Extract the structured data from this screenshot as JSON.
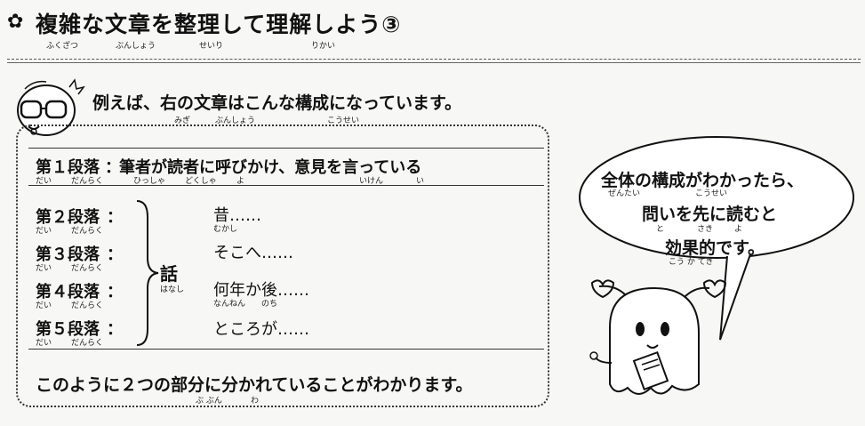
{
  "header": {
    "title": "複雑な文章を整理して理解しよう③",
    "ruby": [
      "ふくざつ",
      "ぶんしょう",
      "せいり",
      "りかい"
    ]
  },
  "intro": {
    "text": "例えば、右の文章はこんな構成になっています。",
    "ruby": [
      "みぎ",
      "ぶんしょう",
      "こうせい"
    ]
  },
  "para1": {
    "label": "第１段落",
    "ruby_label": [
      "だい",
      "だんらく"
    ],
    "text": "筆者が読者に呼びかけ、意見を言っている",
    "ruby_text": [
      "ひっしゃ",
      "どくしゃ",
      "よ",
      "いけん",
      "い"
    ]
  },
  "story_paras": [
    {
      "label": "第２段落",
      "content": "昔……",
      "ruby": "むかし"
    },
    {
      "label": "第３段落",
      "content": "そこへ……",
      "ruby": ""
    },
    {
      "label": "第４段落",
      "content": "何年か後……",
      "ruby": "なんねん　　のち"
    },
    {
      "label": "第５段落",
      "content": "ところが……",
      "ruby": ""
    }
  ],
  "label_ruby": [
    "だい",
    "だんらく"
  ],
  "colon": "：",
  "story": {
    "label": "話",
    "ruby": "はなし"
  },
  "summary": {
    "text": "このように２つの部分に分かれていることがわかります。",
    "ruby": [
      "ぶ ぶん",
      "わ"
    ]
  },
  "speech": {
    "line1": "全体の構成がわかったら、",
    "line2": "問いを先に読むと",
    "line3": "効果的です。",
    "ruby1": [
      "ぜんたい",
      "こうせい"
    ],
    "ruby2": [
      "と",
      "さき",
      "よ"
    ],
    "ruby3": "こう か てき"
  }
}
